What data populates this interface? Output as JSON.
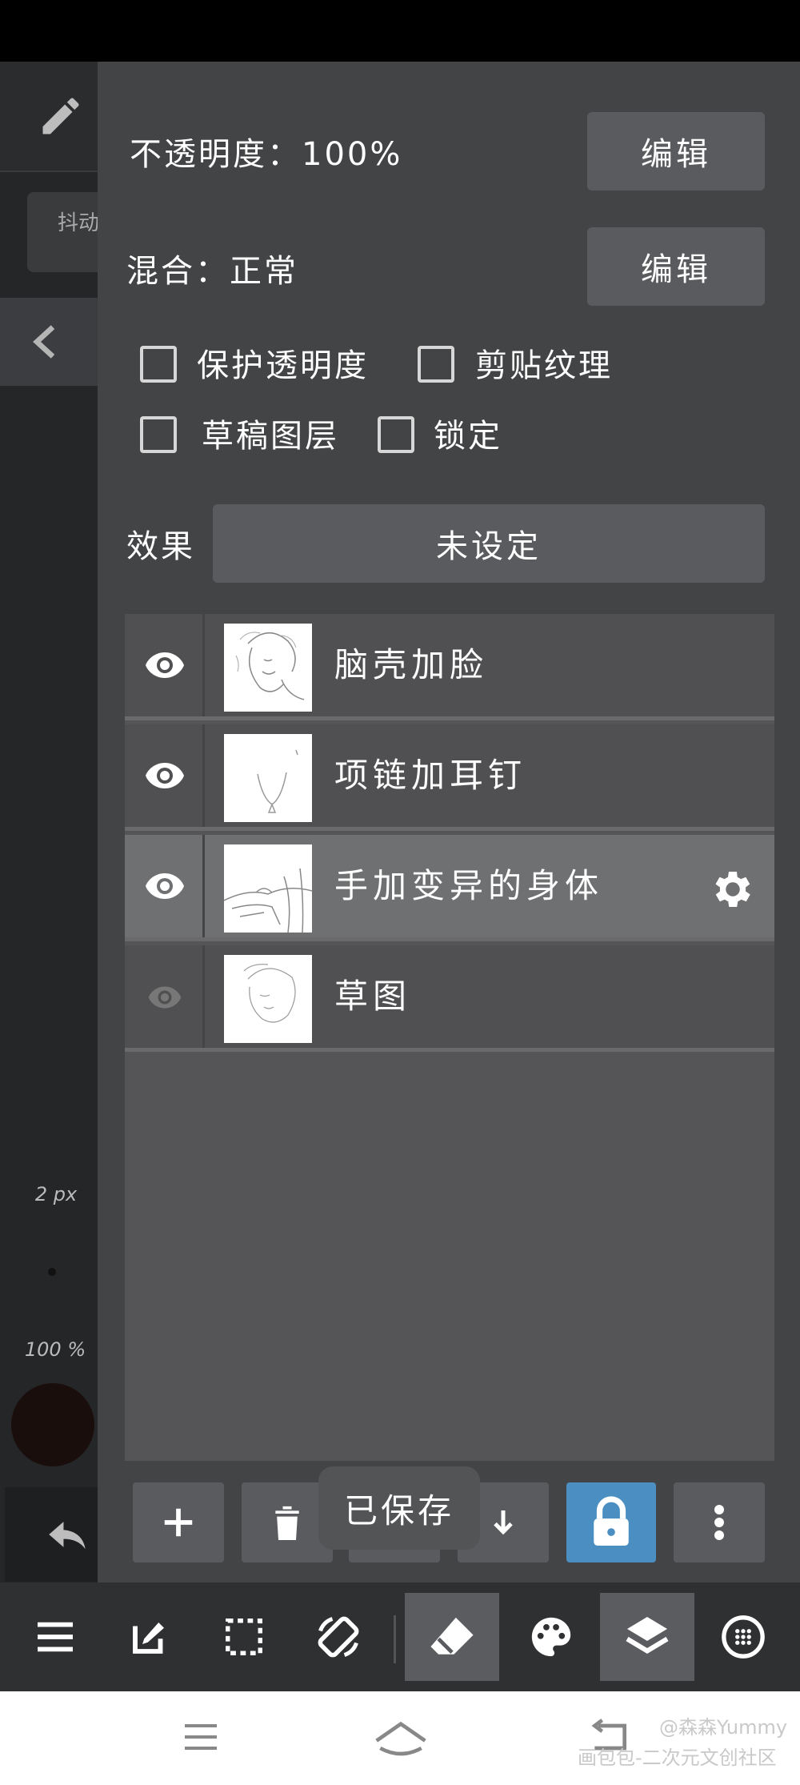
{
  "properties": {
    "opacity_label": "不透明度：100%",
    "opacity_edit": "编辑",
    "blend_label": "混合：正常",
    "blend_edit": "编辑",
    "checkboxes": {
      "protect_alpha": "保护透明度",
      "clipping": "剪贴纹理",
      "draft_layer": "草稿图层",
      "lock": "锁定"
    },
    "effect_label": "效果",
    "effect_value": "未设定"
  },
  "layers": [
    {
      "name": "脑壳加脸",
      "visible": true,
      "selected": false
    },
    {
      "name": "项链加耳钉",
      "visible": true,
      "selected": false
    },
    {
      "name": "手加变异的身体",
      "visible": true,
      "selected": true
    },
    {
      "name": "草图",
      "visible": false,
      "selected": false
    }
  ],
  "left_strip": {
    "brush_name": "抖动",
    "brush_size": "2 px",
    "brush_opacity": "100 %"
  },
  "toast": "已保存",
  "layer_toolbar": {
    "icons": [
      "add-layer-icon",
      "delete-layer-icon",
      "merge-icon",
      "move-down-icon",
      "lock-icon",
      "more-icon"
    ],
    "lock_color": "#4a8ec2"
  },
  "bottom_toolbar": {
    "icons": [
      "menu-icon",
      "edit-icon",
      "selection-icon",
      "rotate-icon",
      "eraser-icon",
      "palette-icon",
      "layers-icon",
      "grid-icon"
    ],
    "active": [
      "eraser-icon",
      "layers-icon"
    ]
  },
  "watermark": {
    "user": "@森森Yummy",
    "site": "画包包-二次元文创社区"
  }
}
